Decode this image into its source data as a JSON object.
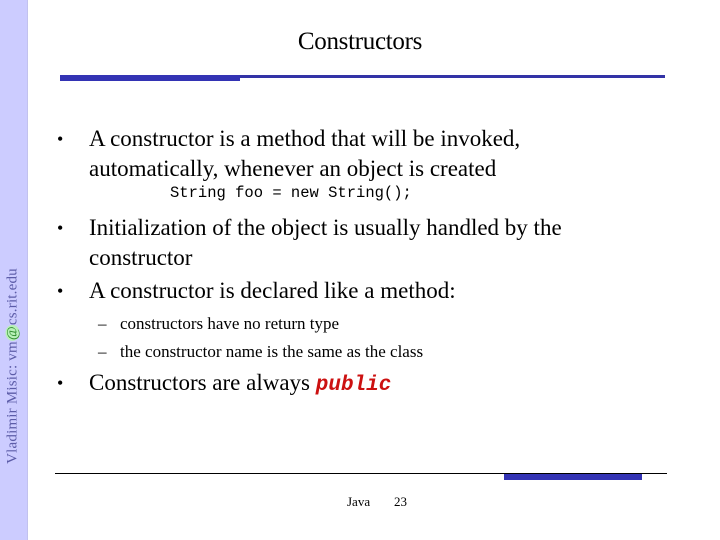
{
  "sidebar": {
    "author_prefix": "Vladimir Misic: vm",
    "author_at": "@",
    "author_suffix": "cs.rit.edu"
  },
  "slide": {
    "title": "Constructors",
    "bullets": [
      {
        "marker": "•",
        "lines": [
          "A constructor is a method that will be invoked,",
          "automatically, whenever an object is created"
        ]
      },
      {
        "marker": "•",
        "lines": [
          "Initialization of the object is usually handled by the",
          "constructor"
        ]
      },
      {
        "marker": "•",
        "lines": [
          "A constructor is declared like a method:"
        ]
      },
      {
        "marker": "•",
        "text": "Constructors are always ",
        "keyword": "public"
      }
    ],
    "code_example": "String foo = new String();",
    "sub_bullets": [
      {
        "marker": "–",
        "text": "constructors have no return type"
      },
      {
        "marker": "–",
        "text": "the constructor name is the same as the class"
      }
    ]
  },
  "footer": {
    "course": "Java",
    "page_number": "23"
  },
  "colors": {
    "sidebar_bg": "#ccccff",
    "accent_bar": "#3333b4",
    "keyword": "#cc1111"
  }
}
